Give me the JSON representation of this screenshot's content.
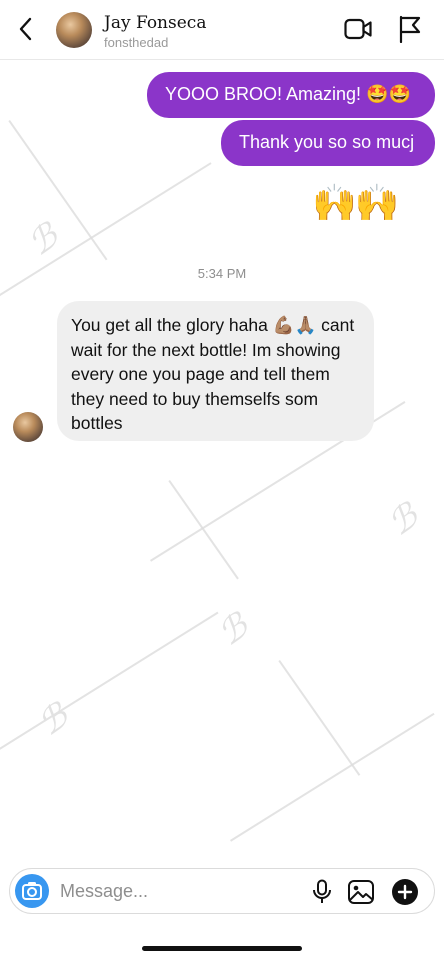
{
  "header": {
    "back_icon": "chevron-left-icon",
    "contact_name": "Jay Fonseca",
    "contact_handle": "fonsthedad",
    "video_icon": "video-camera-icon",
    "report_icon": "flag-icon"
  },
  "messages": {
    "outgoing": [
      {
        "text": "YOOO BROO! Amazing! 🤩🤩"
      },
      {
        "text": "Thank you so so mucj"
      },
      {
        "text": "🙌🙌"
      }
    ],
    "timestamp": "5:34 PM",
    "incoming": [
      {
        "text": "You get all the glory haha 💪🏽🙏🏽 cant wait for the next bottle! Im showing every one you page and tell them they need to buy themselfs som bottles"
      }
    ]
  },
  "composer": {
    "placeholder": "Message...",
    "camera_icon": "camera-icon",
    "mic_icon": "microphone-icon",
    "gallery_icon": "image-icon",
    "add_icon": "plus-circle-icon"
  },
  "colors": {
    "outgoing_bubble": "#8b35c9",
    "incoming_bubble": "#efefef",
    "camera_button": "#3897f0"
  }
}
